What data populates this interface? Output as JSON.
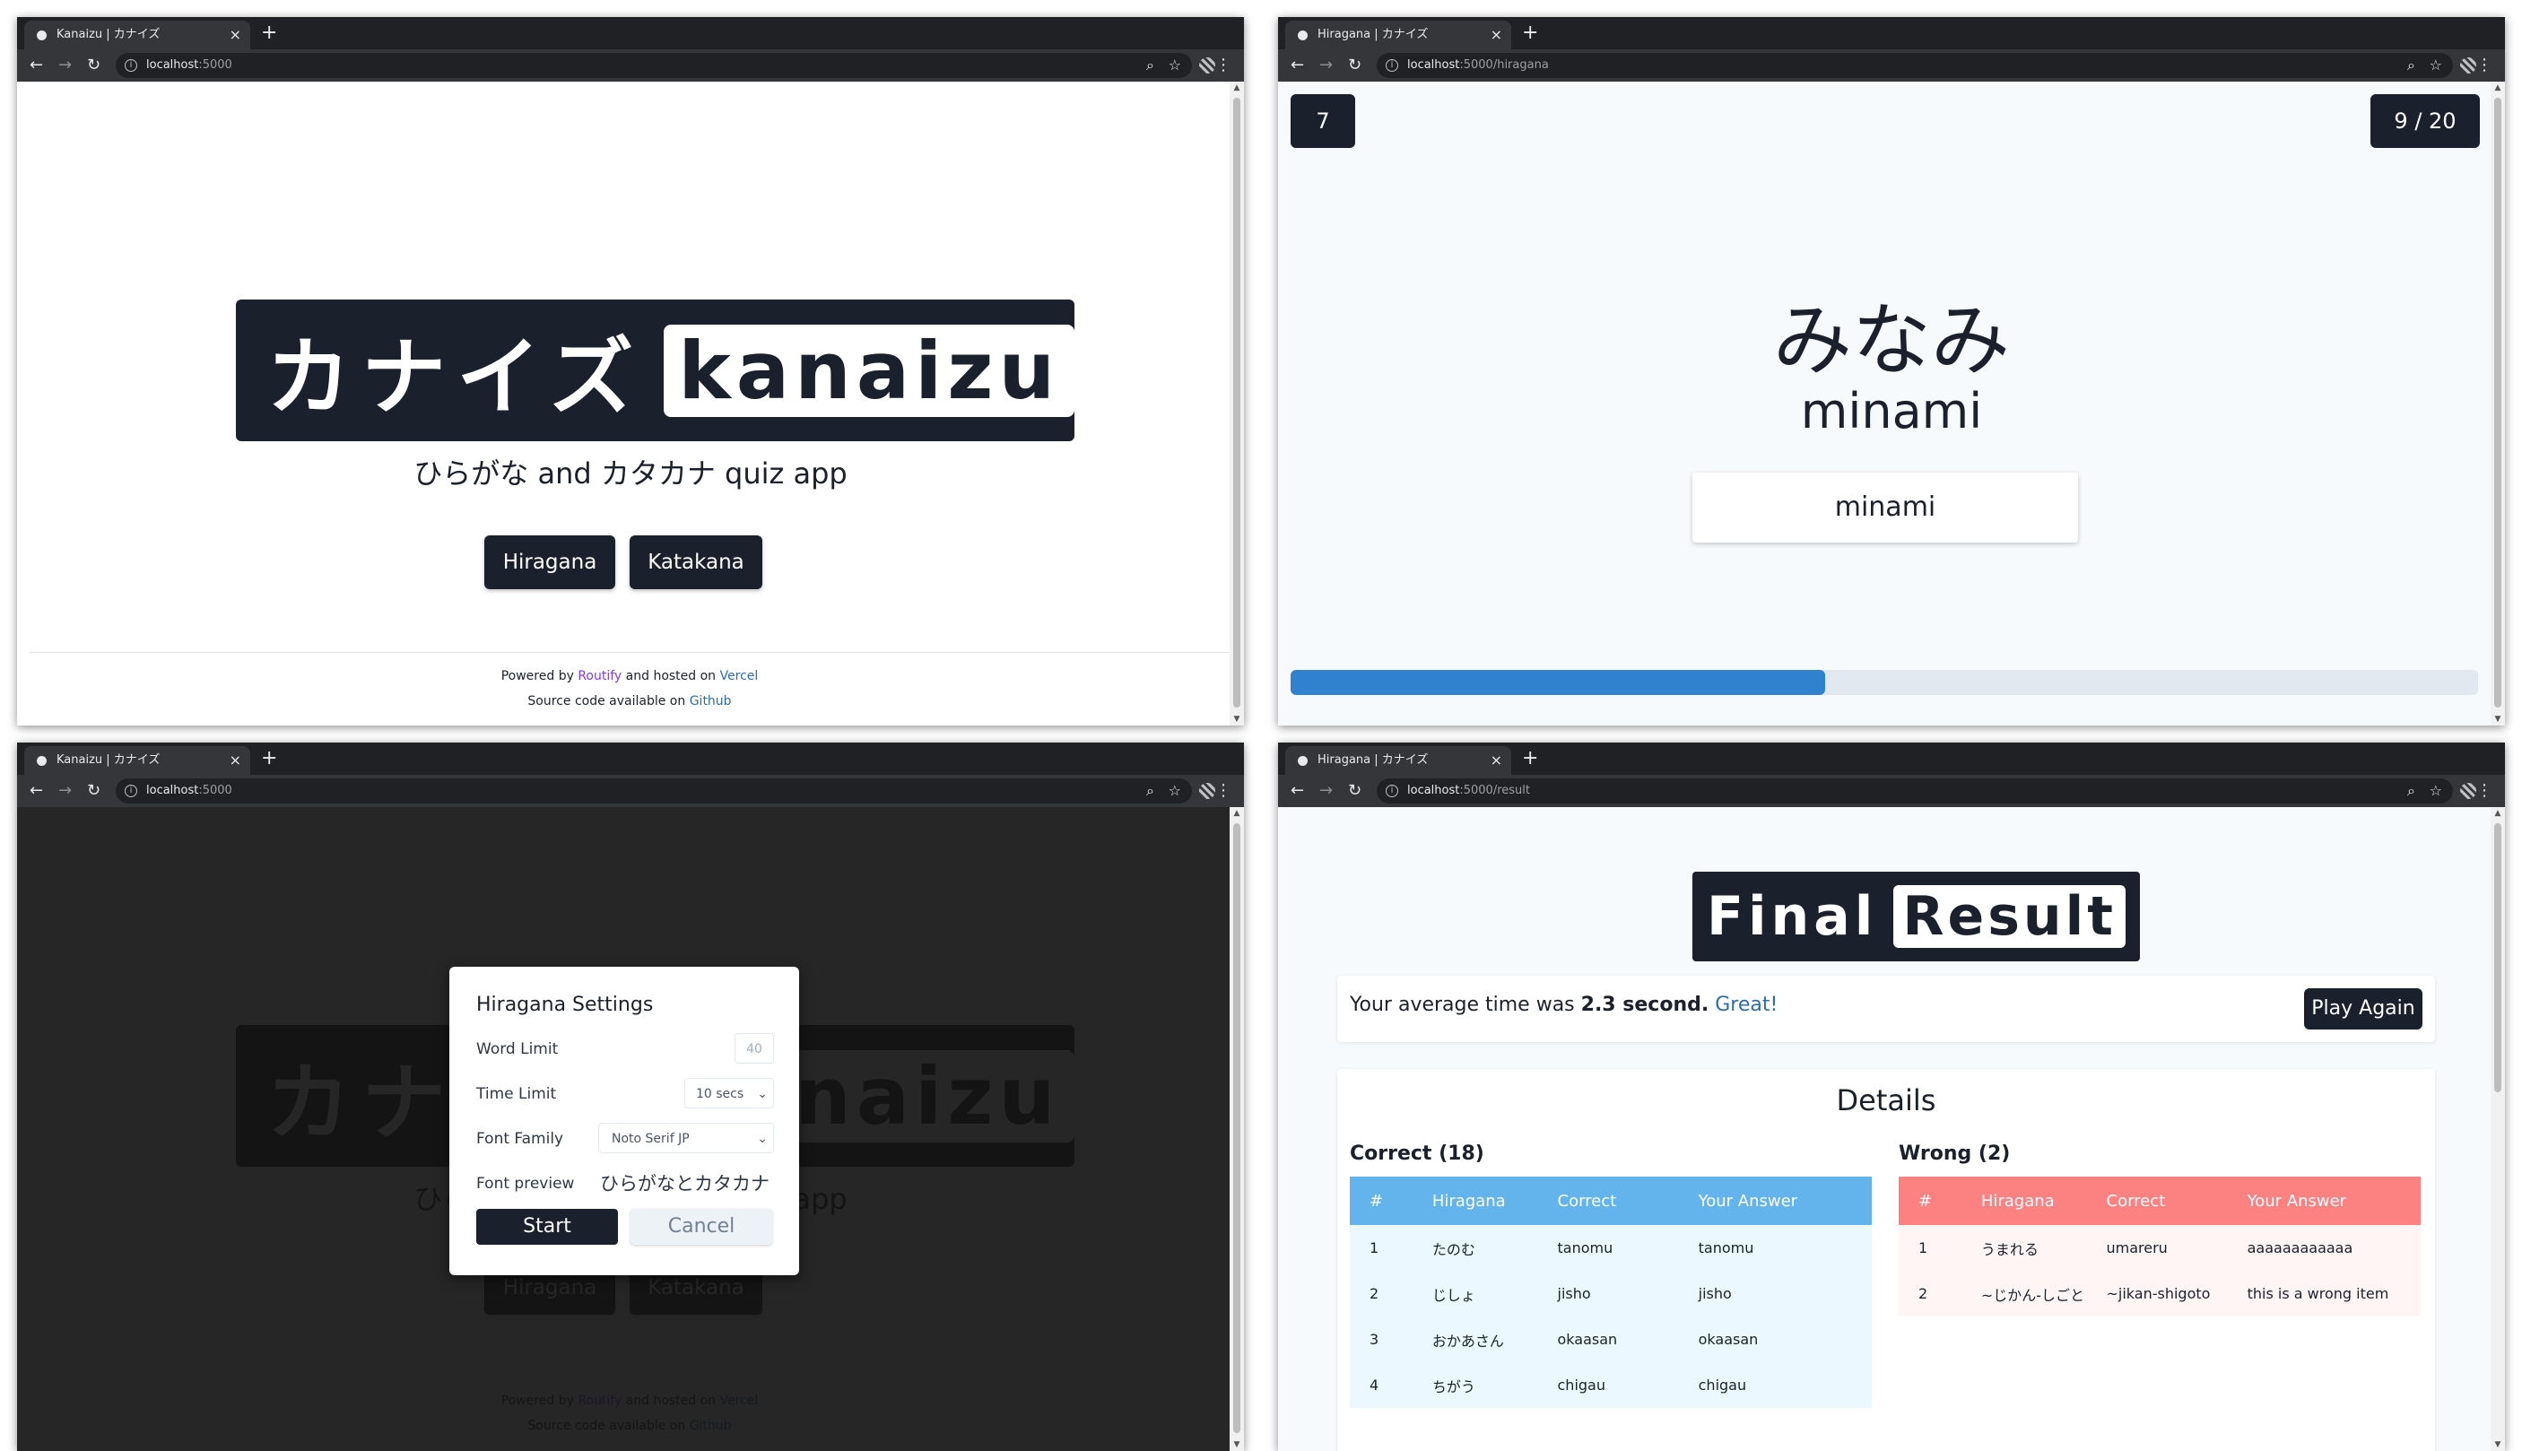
{
  "windows": {
    "w1": {
      "tab_title": "Kanaizu | カナイズ",
      "url_host": "localhost",
      "url_path": ":5000",
      "logo_kana": "カナイズ",
      "logo_latin": "kanaizu",
      "subtitle": "ひらがな and カタカナ quiz app",
      "btn_hiragana": "Hiragana",
      "btn_katakana": "Katakana",
      "footer": {
        "line1_pre": "Powered by ",
        "line1_link1": "Routify",
        "line1_mid": " and hosted on ",
        "line1_link2": "Vercel",
        "line2_pre": "Source code available on ",
        "line2_link": "Github"
      }
    },
    "w2": {
      "tab_title": "Hiragana | カナイズ",
      "url_host": "localhost",
      "url_path": ":5000/hiragana",
      "timer": "7",
      "counter": "9 / 20",
      "word_kana": "みなみ",
      "word_romaji": "minami",
      "answer_value": "minami",
      "progress_fraction": 0.45
    },
    "w3": {
      "tab_title": "Kanaizu | カナイズ",
      "url_host": "localhost",
      "url_path": ":5000",
      "modal": {
        "title": "Hiragana Settings",
        "word_limit_label": "Word Limit",
        "word_limit_placeholder": "40",
        "time_limit_label": "Time Limit",
        "time_limit_value": "10 secs",
        "font_family_label": "Font Family",
        "font_family_value": "Noto Serif JP",
        "font_preview_label": "Font preview",
        "font_preview_text": "ひらがなとカタカナ",
        "start_label": "Start",
        "cancel_label": "Cancel"
      }
    },
    "w4": {
      "tab_title": "Hiragana | カナイズ",
      "url_host": "localhost",
      "url_path": ":5000/result",
      "title_a": "Final",
      "title_b": "Result",
      "avg_pre": "Your average time was ",
      "avg_value": "2.3 second.",
      "avg_comment": "Great!",
      "play_again": "Play Again",
      "details_title": "Details",
      "correct_label": "Correct (18)",
      "wrong_label": "Wrong (2)",
      "headers": [
        "#",
        "Hiragana",
        "Correct",
        "Your Answer"
      ],
      "correct_rows": [
        [
          "1",
          "たのむ",
          "tanomu",
          "tanomu"
        ],
        [
          "2",
          "じしょ",
          "jisho",
          "jisho"
        ],
        [
          "3",
          "おかあさん",
          "okaasan",
          "okaasan"
        ],
        [
          "4",
          "ちがう",
          "chigau",
          "chigau"
        ]
      ],
      "wrong_rows": [
        [
          "1",
          "うまれる",
          "umareru",
          "aaaaaaaaaaaa"
        ],
        [
          "2",
          "~じかん-しごと",
          "~jikan-shigoto",
          "this is a wrong item"
        ]
      ]
    }
  },
  "colors": {
    "dark": "#1a202c",
    "progress": "#3182ce",
    "correct_header": "#63b3ed",
    "wrong_header": "#fc8181"
  }
}
